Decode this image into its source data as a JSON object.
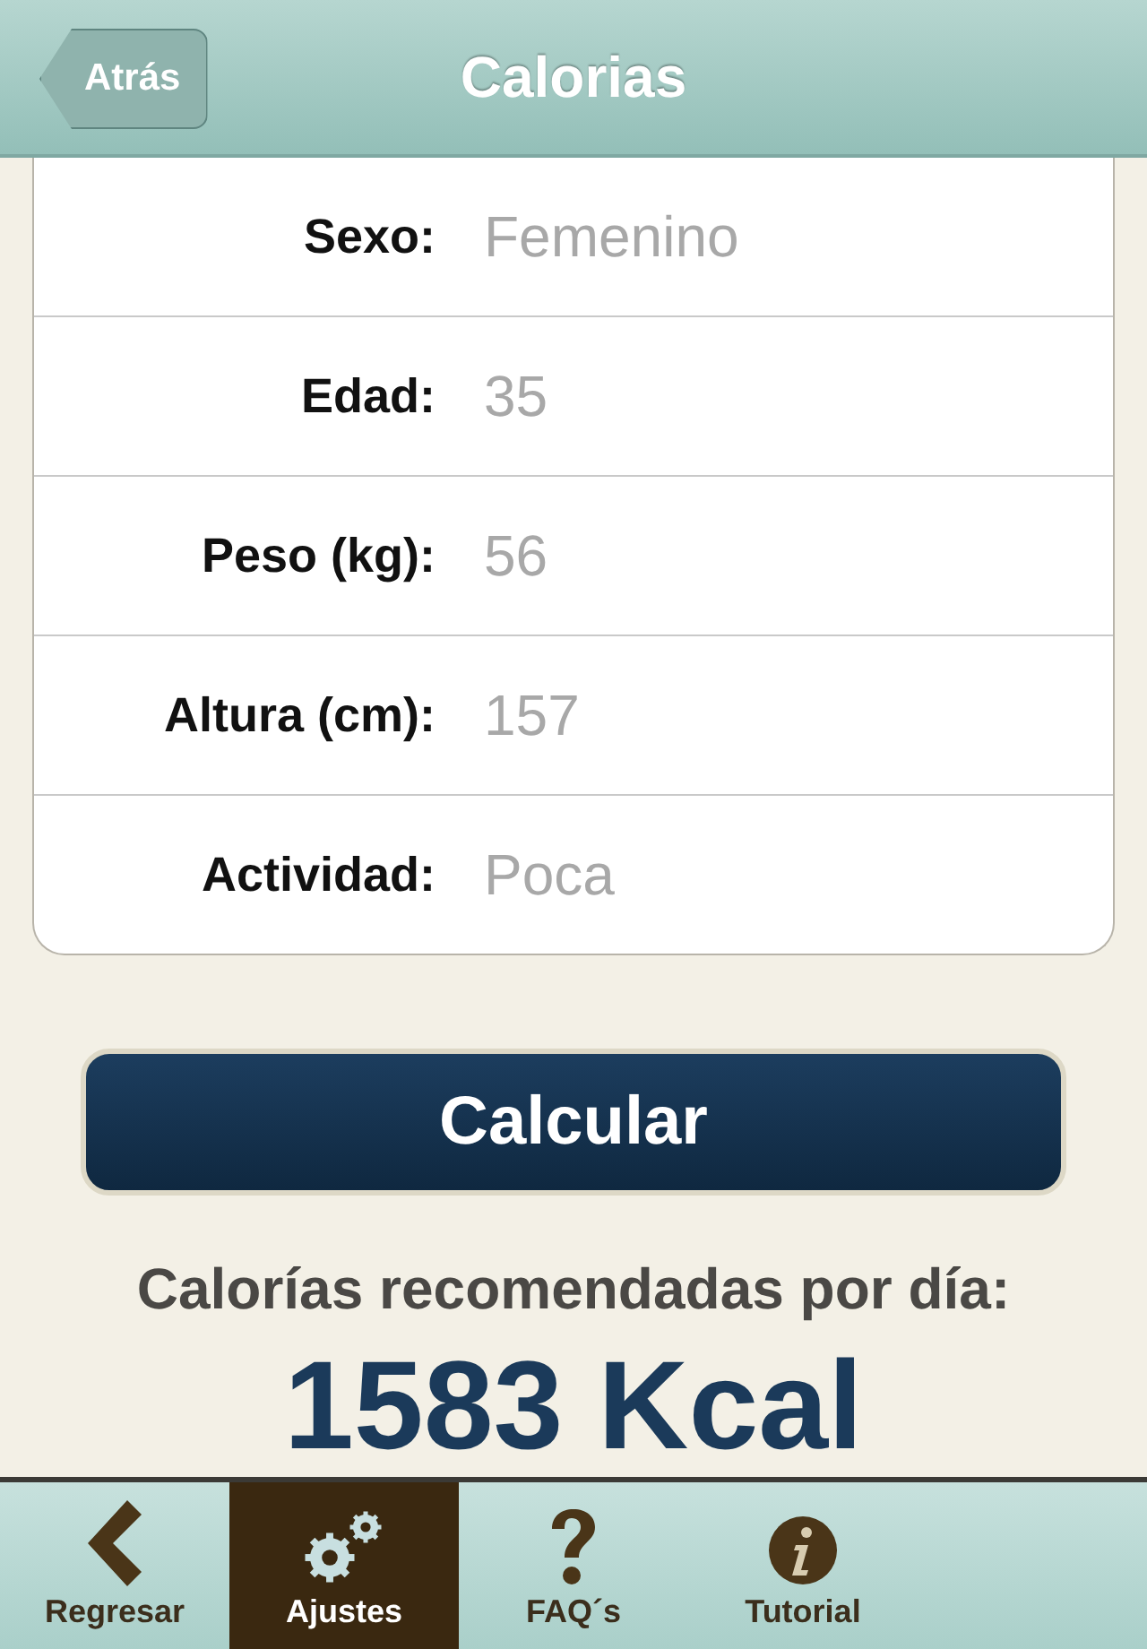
{
  "nav_bar": {
    "back_button": "Atrás",
    "title": "Calorias"
  },
  "form": [
    {
      "label": "Sexo:",
      "value": "Femenino"
    },
    {
      "label": "Edad:",
      "value": "35"
    },
    {
      "label": "Peso (kg):",
      "value": "56"
    },
    {
      "label": "Altura (cm):",
      "value": "157"
    },
    {
      "label": "Actividad:",
      "value": "Poca"
    }
  ],
  "calculate_button": "Calcular",
  "result": {
    "label": "Calorías recomendadas por día:",
    "value": "1583 Kcal"
  },
  "tab_bar": [
    {
      "label": "Regresar",
      "kind": "back",
      "selected": false
    },
    {
      "label": "Ajustes",
      "kind": "gears",
      "selected": true
    },
    {
      "label": "FAQ´s",
      "kind": "question",
      "selected": false
    },
    {
      "label": "Tutorial",
      "kind": "info",
      "selected": false
    }
  ]
}
